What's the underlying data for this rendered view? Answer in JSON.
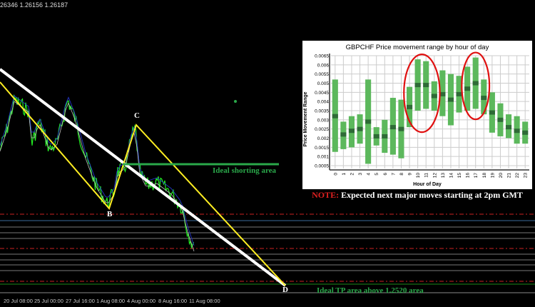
{
  "header": {
    "ohlc_text": "26346 1.26156 1.26187"
  },
  "annotations": {
    "point_b": "B",
    "point_c": "C",
    "point_d": "D",
    "shorting_label": "Ideal shorting area",
    "tp_label": "Ideal TP area above 1.2520 area"
  },
  "time_axis": [
    "20 Jul 08:00",
    "25 Jul 00:00",
    "27 Jul 16:00",
    "1 Aug 08:00",
    "4 Aug 00:00",
    "8 Aug 16:00",
    "11 Aug 08:00"
  ],
  "note": {
    "prefix": "NOTE:",
    "text": " Expected next major moves starting at 2pm GMT"
  },
  "colors": {
    "price": "#22ee22",
    "channel": "#ffffff",
    "abcd": "#ffee22",
    "short_line": "#2aa84a",
    "box": "#5cb85c",
    "median": "#2e6b36",
    "highlight": "#e01010"
  },
  "chart_data": {
    "type": "boxplot",
    "title": "GBPCHF Price movement range by hour of day",
    "xlabel": "Hour of Day",
    "ylabel": "Price Movement Range",
    "ylim": [
      0.0005,
      0.0065
    ],
    "yticks": [
      "0.0005",
      "0.001",
      "0.0015",
      "0.002",
      "0.0025",
      "0.003",
      "0.0035",
      "0.004",
      "0.0045",
      "0.005",
      "0.0055",
      "0.006",
      "0.0065"
    ],
    "categories": [
      "0",
      "1",
      "2",
      "3",
      "4",
      "5",
      "6",
      "7",
      "8",
      "9",
      "10",
      "11",
      "12",
      "13",
      "14",
      "15",
      "16",
      "17",
      "18",
      "19",
      "20",
      "21",
      "22",
      "23"
    ],
    "low": [
      0.00125,
      0.0014,
      0.0015,
      0.0017,
      0.0006,
      0.0016,
      0.0012,
      0.0011,
      0.0009,
      0.0026,
      0.0035,
      0.0036,
      0.0035,
      0.0032,
      0.0027,
      0.0034,
      0.0035,
      0.0036,
      0.0033,
      0.0023,
      0.0021,
      0.002,
      0.0017,
      0.0017
    ],
    "high": [
      0.0052,
      0.0029,
      0.0032,
      0.0033,
      0.0052,
      0.0026,
      0.003,
      0.0042,
      0.0041,
      0.0048,
      0.0063,
      0.0062,
      0.0051,
      0.0057,
      0.0055,
      0.0054,
      0.0059,
      0.0064,
      0.0052,
      0.0045,
      0.0039,
      0.0033,
      0.0032,
      0.0029
    ],
    "median": [
      0.0032,
      0.0022,
      0.0024,
      0.0025,
      0.0029,
      0.0021,
      0.0021,
      0.0026,
      0.0025,
      0.0037,
      0.0049,
      0.0049,
      0.0043,
      0.0044,
      0.0041,
      0.0044,
      0.0047,
      0.005,
      0.0042,
      0.0034,
      0.003,
      0.0026,
      0.0024,
      0.0023
    ],
    "highlighted_hours": [
      [
        9,
        12
      ],
      [
        16,
        18
      ]
    ],
    "grid": true
  }
}
